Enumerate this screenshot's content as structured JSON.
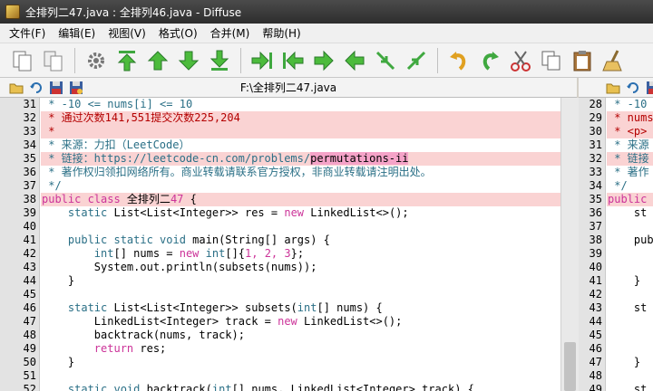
{
  "window": {
    "title": "全排列二47.java : 全排列46.java - Diffuse"
  },
  "menu": [
    "文件(F)",
    "编辑(E)",
    "视图(V)",
    "格式(O)",
    "合并(M)",
    "帮助(H)"
  ],
  "file_left": {
    "path": "F:\\全排列二47.java"
  },
  "left_lines": [
    {
      "n": "31",
      "diff": false,
      "segs": [
        [
          "cm",
          " * -10 <= nums[i] <= 10"
        ]
      ]
    },
    {
      "n": "32",
      "diff": true,
      "segs": [
        [
          "red",
          " * 通过次数141,551提交次数225,204"
        ]
      ]
    },
    {
      "n": "33",
      "diff": true,
      "segs": [
        [
          "red",
          " *"
        ]
      ]
    },
    {
      "n": "34",
      "diff": false,
      "segs": [
        [
          "cm",
          " * 来源：力扣（LeetCode）"
        ]
      ]
    },
    {
      "n": "35",
      "diff": true,
      "segs": [
        [
          "cm",
          " * 链接：https://leetcode-cn.com/problems/"
        ],
        [
          "hl",
          "permutations-ii"
        ]
      ]
    },
    {
      "n": "36",
      "diff": false,
      "segs": [
        [
          "cm",
          " * 著作权归领扣网络所有。商业转载请联系官方授权，非商业转载请注明出处。"
        ]
      ]
    },
    {
      "n": "37",
      "diff": false,
      "segs": [
        [
          "cm",
          " */"
        ]
      ]
    },
    {
      "n": "38",
      "diff": true,
      "segs": [
        [
          "kw2",
          "public class "
        ],
        [
          "",
          "全排列二"
        ],
        [
          "num-lit",
          "47"
        ],
        [
          "",
          " {"
        ]
      ]
    },
    {
      "n": "39",
      "diff": false,
      "segs": [
        [
          "",
          "    "
        ],
        [
          "kw",
          "static"
        ],
        [
          "",
          " List<List<Integer>> res = "
        ],
        [
          "kw2",
          "new"
        ],
        [
          "",
          " LinkedList<>();"
        ]
      ]
    },
    {
      "n": "40",
      "diff": false,
      "segs": [
        [
          "",
          ""
        ]
      ]
    },
    {
      "n": "41",
      "diff": false,
      "segs": [
        [
          "",
          "    "
        ],
        [
          "kw",
          "public static void"
        ],
        [
          "",
          " main(String[] args) {"
        ]
      ]
    },
    {
      "n": "42",
      "diff": false,
      "segs": [
        [
          "",
          "        "
        ],
        [
          "kw",
          "int"
        ],
        [
          "",
          "[] nums = "
        ],
        [
          "kw2",
          "new"
        ],
        [
          "",
          " "
        ],
        [
          "kw",
          "int"
        ],
        [
          "",
          "[]{"
        ],
        [
          "num-lit",
          "1, 2, 3"
        ],
        [
          "",
          "};"
        ]
      ]
    },
    {
      "n": "43",
      "diff": false,
      "segs": [
        [
          "",
          "        System.out.println(subsets(nums));"
        ]
      ]
    },
    {
      "n": "44",
      "diff": false,
      "segs": [
        [
          "",
          "    }"
        ]
      ]
    },
    {
      "n": "45",
      "diff": false,
      "segs": [
        [
          "",
          ""
        ]
      ]
    },
    {
      "n": "46",
      "diff": false,
      "segs": [
        [
          "",
          "    "
        ],
        [
          "kw",
          "static"
        ],
        [
          "",
          " List<List<Integer>> subsets("
        ],
        [
          "kw",
          "int"
        ],
        [
          "",
          "[] nums) {"
        ]
      ]
    },
    {
      "n": "47",
      "diff": false,
      "segs": [
        [
          "",
          "        LinkedList<Integer> track = "
        ],
        [
          "kw2",
          "new"
        ],
        [
          "",
          " LinkedList<>();"
        ]
      ]
    },
    {
      "n": "48",
      "diff": false,
      "segs": [
        [
          "",
          "        backtrack(nums, track);"
        ]
      ]
    },
    {
      "n": "49",
      "diff": false,
      "segs": [
        [
          "",
          "        "
        ],
        [
          "kw2",
          "return"
        ],
        [
          "",
          " res;"
        ]
      ]
    },
    {
      "n": "50",
      "diff": false,
      "segs": [
        [
          "",
          "    }"
        ]
      ]
    },
    {
      "n": "51",
      "diff": false,
      "segs": [
        [
          "",
          ""
        ]
      ]
    },
    {
      "n": "52",
      "diff": false,
      "segs": [
        [
          "",
          "    "
        ],
        [
          "kw",
          "static void"
        ],
        [
          "",
          " backtrack("
        ],
        [
          "kw",
          "int"
        ],
        [
          "",
          "[] nums, LinkedList<Integer> track) {"
        ]
      ]
    }
  ],
  "right_lines": [
    {
      "n": "28",
      "diff": false,
      "segs": [
        [
          "cm",
          " * -10"
        ]
      ]
    },
    {
      "n": "29",
      "diff": true,
      "segs": [
        [
          "red",
          " * nums"
        ]
      ]
    },
    {
      "n": "30",
      "diff": true,
      "segs": [
        [
          "red",
          " * <p>"
        ]
      ]
    },
    {
      "n": "31",
      "diff": false,
      "segs": [
        [
          "cm",
          " * 来源"
        ]
      ]
    },
    {
      "n": "32",
      "diff": true,
      "segs": [
        [
          "cm",
          " * 链接"
        ]
      ]
    },
    {
      "n": "33",
      "diff": false,
      "segs": [
        [
          "cm",
          " * 著作"
        ]
      ]
    },
    {
      "n": "34",
      "diff": false,
      "segs": [
        [
          "cm",
          " */"
        ]
      ]
    },
    {
      "n": "35",
      "diff": true,
      "segs": [
        [
          "kw2",
          "public"
        ]
      ]
    },
    {
      "n": "36",
      "diff": false,
      "segs": [
        [
          "",
          "    st"
        ]
      ]
    },
    {
      "n": "37",
      "diff": false,
      "segs": [
        [
          "",
          ""
        ]
      ]
    },
    {
      "n": "38",
      "diff": false,
      "segs": [
        [
          "",
          "    pub"
        ]
      ]
    },
    {
      "n": "39",
      "diff": false,
      "segs": [
        [
          "",
          ""
        ]
      ]
    },
    {
      "n": "40",
      "diff": false,
      "segs": [
        [
          "",
          ""
        ]
      ]
    },
    {
      "n": "41",
      "diff": false,
      "segs": [
        [
          "",
          "    }"
        ]
      ]
    },
    {
      "n": "42",
      "diff": false,
      "segs": [
        [
          "",
          ""
        ]
      ]
    },
    {
      "n": "43",
      "diff": false,
      "segs": [
        [
          "",
          "    st"
        ]
      ]
    },
    {
      "n": "44",
      "diff": false,
      "segs": [
        [
          "",
          ""
        ]
      ]
    },
    {
      "n": "45",
      "diff": false,
      "segs": [
        [
          "",
          ""
        ]
      ]
    },
    {
      "n": "46",
      "diff": false,
      "segs": [
        [
          "",
          ""
        ]
      ]
    },
    {
      "n": "47",
      "diff": false,
      "segs": [
        [
          "",
          "    }"
        ]
      ]
    },
    {
      "n": "48",
      "diff": false,
      "segs": [
        [
          "",
          ""
        ]
      ]
    },
    {
      "n": "49",
      "diff": false,
      "segs": [
        [
          "",
          "    st"
        ]
      ]
    }
  ],
  "colors": {
    "diff_bg": "#fad3d3",
    "gutter": "#e3e3e3"
  }
}
